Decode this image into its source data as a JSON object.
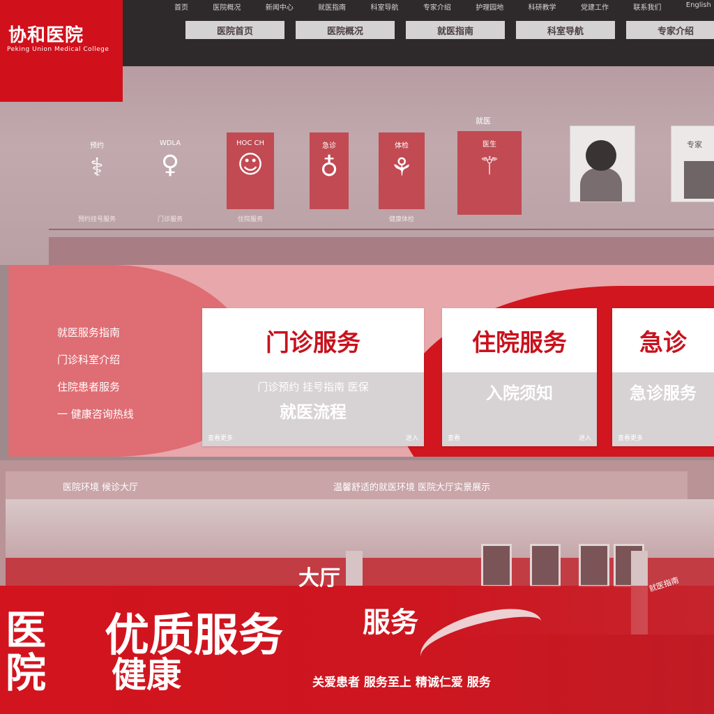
{
  "logo": {
    "title": "协和医院",
    "subtitle": "Peking Union Medical College"
  },
  "utility": [
    "首页",
    "医院概况",
    "新闻中心",
    "就医指南",
    "科室导航",
    "专家介绍",
    "护理园地",
    "科研教学",
    "党建工作",
    "联系我们",
    "English"
  ],
  "nav": [
    "医院首页",
    "医院概况",
    "就医指南",
    "科室导航",
    "专家介绍"
  ],
  "banner": {
    "icon_cards": [
      {
        "label": "预约",
        "glyph": "⚕",
        "caption": "预约挂号服务"
      },
      {
        "label": "WDLA",
        "glyph": "♀",
        "caption": "门诊服务"
      },
      {
        "label": "HOC CH",
        "glyph": "☺",
        "caption": "住院服务"
      },
      {
        "label": "急诊",
        "glyph": "♁",
        "caption": ""
      },
      {
        "label": "体检",
        "glyph": "⚘",
        "caption": "健康体检"
      },
      {
        "label": "医生",
        "glyph": "⚚",
        "caption": ""
      }
    ],
    "header_tag": "就医",
    "photo_label": "专家"
  },
  "service": {
    "items": [
      "就医服务指南",
      "门诊科室介绍",
      "住院患者服务",
      "一 健康咨询热线"
    ],
    "cards": [
      {
        "title": "门诊服务",
        "line1": "门诊预约 挂号指南 医保",
        "line2": "就医流程",
        "foot_left": "查看更多",
        "foot_right": "进入"
      },
      {
        "title": "住院服务",
        "line1": "",
        "line2": "入院须知",
        "foot_left": "查看",
        "foot_right": "进入"
      },
      {
        "title": "急诊",
        "line1": "",
        "line2": "急诊服务",
        "foot_left": "查看更多",
        "foot_right": ""
      }
    ]
  },
  "hall": {
    "strip_left": "医院环境 候诊大厅",
    "strip_right": "温馨舒适的就医环境 医院大厅实景展示",
    "big_left": "医院",
    "big_center": "优质服务",
    "big_center2": "健康",
    "mid_text": "大厅",
    "right_text": "服务",
    "sub": "关爱患者 服务至上 精诚仁爱 服务",
    "side_tag": "就医指南"
  },
  "colors": {
    "brand_red": "#d0101b",
    "header_dark": "#2e2a2b",
    "card_red_text": "#c8121d"
  }
}
